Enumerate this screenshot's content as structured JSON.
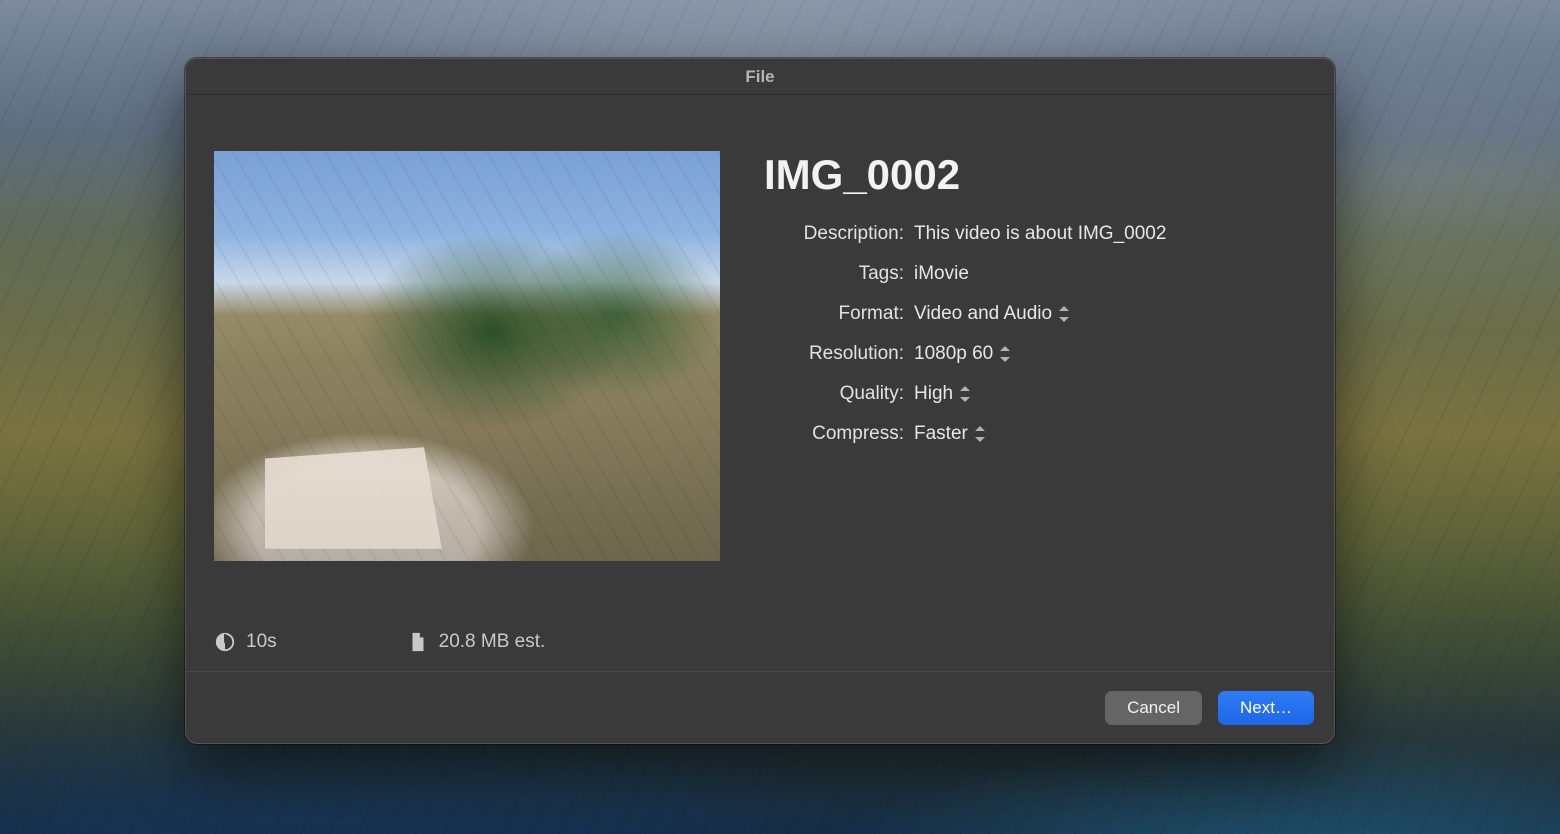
{
  "dialog": {
    "title": "File",
    "file_title": "IMG_0002",
    "fields": {
      "description": {
        "label": "Description:",
        "value": "This video is about IMG_0002"
      },
      "tags": {
        "label": "Tags:",
        "value": "iMovie"
      },
      "format": {
        "label": "Format:",
        "value": "Video and Audio"
      },
      "resolution": {
        "label": "Resolution:",
        "value": "1080p 60"
      },
      "quality": {
        "label": "Quality:",
        "value": "High"
      },
      "compress": {
        "label": "Compress:",
        "value": "Faster"
      }
    },
    "meta": {
      "duration": "10s",
      "estimated_size": "20.8 MB est."
    },
    "buttons": {
      "cancel": "Cancel",
      "next": "Next…"
    }
  }
}
